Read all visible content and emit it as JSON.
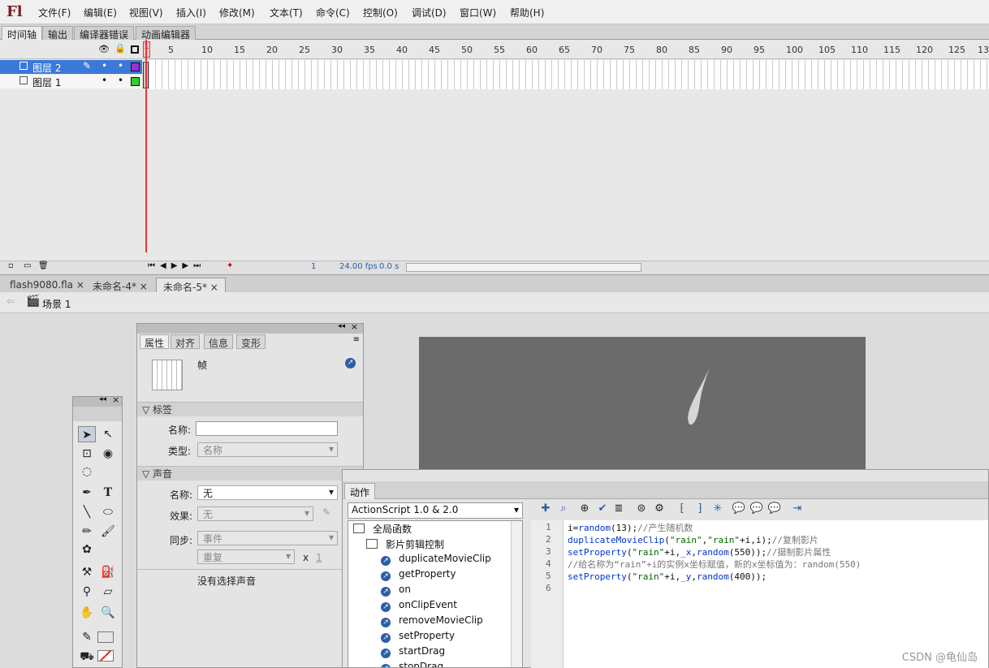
{
  "app": {
    "logo": "Fl"
  },
  "menu": [
    "文件(F)",
    "编辑(E)",
    "视图(V)",
    "插入(I)",
    "修改(M)",
    "文本(T)",
    "命令(C)",
    "控制(O)",
    "调试(D)",
    "窗口(W)",
    "帮助(H)"
  ],
  "timeline_tabs": [
    "时间轴",
    "输出",
    "编译器错误",
    "动画编辑器"
  ],
  "ruler": [
    "1",
    "5",
    "10",
    "15",
    "20",
    "25",
    "30",
    "35",
    "40",
    "45",
    "50",
    "55",
    "60",
    "65",
    "70",
    "75",
    "80",
    "85",
    "90",
    "95",
    "100",
    "105",
    "110",
    "115",
    "120",
    "125",
    "13"
  ],
  "layers": [
    {
      "name": "图层 2",
      "color": "#9933cc"
    },
    {
      "name": "图层 1",
      "color": "#33cc33"
    }
  ],
  "timeline_status": {
    "frame": "1",
    "fps": "24.00 fps",
    "time": "0.0 s"
  },
  "doc_tabs": [
    "flash9080.fla",
    "未命名-4*",
    "未命名-5*"
  ],
  "scene": "场景 1",
  "properties": {
    "tabs": [
      "属性",
      "对齐",
      "信息",
      "变形"
    ],
    "kind": "帧",
    "label_section": "标签",
    "name_label": "名称:",
    "type_label": "类型:",
    "type_value": "名称",
    "sound_section": "声音",
    "sound_name_label": "名称:",
    "sound_name_value": "无",
    "effect_label": "效果:",
    "effect_value": "无",
    "sync_label": "同步:",
    "sync_value": "事件",
    "repeat_value": "重复",
    "x_label": "x",
    "repeat_count": "1",
    "no_sound": "没有选择声音"
  },
  "actions": {
    "tab": "动作",
    "as_version": "ActionScript 1.0 & 2.0",
    "tree": {
      "root": "全局函数",
      "folder": "影片剪辑控制",
      "items": [
        "duplicateMovieClip",
        "getProperty",
        "on",
        "onClipEvent",
        "removeMovieClip",
        "setProperty",
        "startDrag",
        "stopDrag"
      ]
    },
    "line_numbers": [
      "1",
      "2",
      "3",
      "4",
      "5",
      "6"
    ]
  },
  "watermark": "CSDN @龟仙岛"
}
